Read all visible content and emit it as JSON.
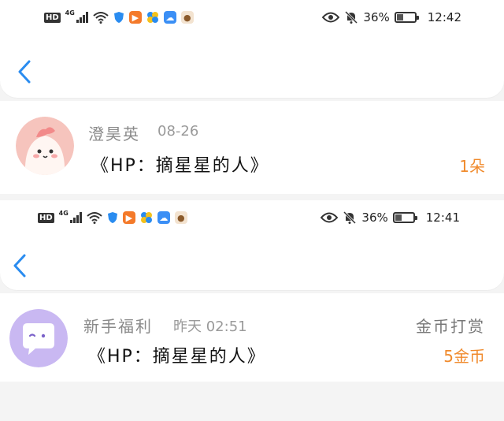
{
  "screen1": {
    "status": {
      "battery": "36%",
      "time": "12:42",
      "battery_level": 0.36
    },
    "entry": {
      "name": "澄昊英",
      "date": "08-26",
      "title": "《HP：摘星星的人》",
      "amount": "1朵"
    }
  },
  "screen2": {
    "status": {
      "battery": "36%",
      "time": "12:41",
      "battery_level": 0.36
    },
    "entry": {
      "name": "新手福利",
      "date": "昨天 02:51",
      "title": "《HP：摘星星的人》",
      "type": "金币打赏",
      "amount": "5金币"
    }
  },
  "icons": [
    "hd-icon",
    "signal-icon",
    "wifi-icon",
    "shield-icon",
    "video-app-icon",
    "pinwheel-app-icon",
    "cloud-app-icon",
    "cake-app-icon",
    "eye-icon",
    "mute-bell-icon",
    "battery-icon",
    "back-chevron-icon"
  ],
  "colors": {
    "accent": "#2a8cf0",
    "amount": "#f08a2c",
    "muted": "#9a9a9a"
  }
}
